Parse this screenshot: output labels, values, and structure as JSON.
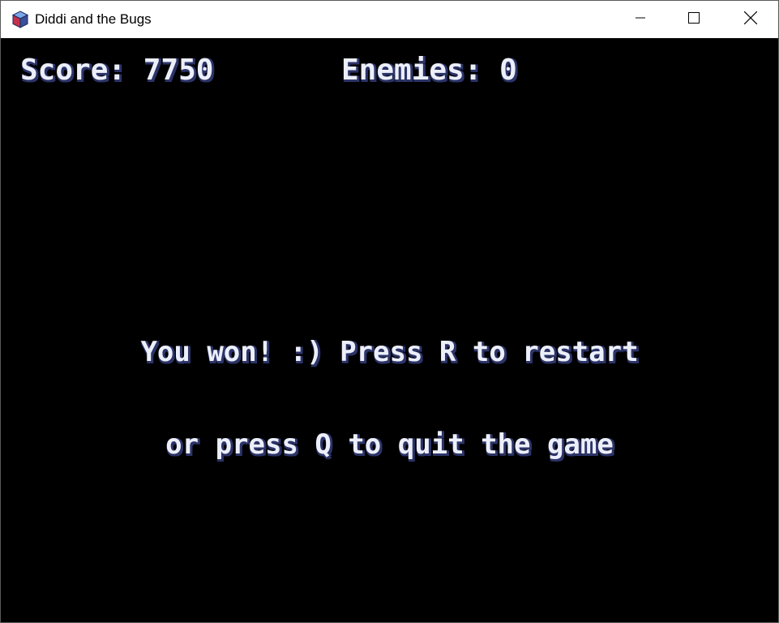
{
  "window": {
    "title": "Diddi and the Bugs",
    "app_icon": "cube-icon",
    "controls": {
      "minimize_icon": "minimize-icon",
      "maximize_icon": "maximize-icon",
      "close_icon": "close-icon"
    }
  },
  "hud": {
    "score_label": "Score: 7750",
    "enemies_label": "Enemies: 0"
  },
  "message": {
    "line1": "You won! :) Press R to restart",
    "line2": "or press Q to quit the game"
  },
  "colors": {
    "background": "#000000",
    "text": "#eceffa",
    "text_shadow": "#2c3468"
  }
}
